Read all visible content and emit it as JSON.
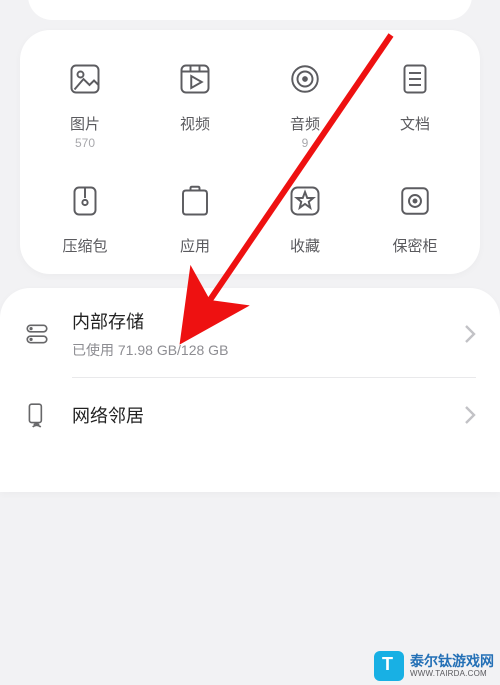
{
  "categories": [
    {
      "key": "pictures",
      "label": "图片",
      "count": "570"
    },
    {
      "key": "videos",
      "label": "视频",
      "count": ""
    },
    {
      "key": "audio",
      "label": "音频",
      "count": "9"
    },
    {
      "key": "documents",
      "label": "文档",
      "count": ""
    },
    {
      "key": "archives",
      "label": "压缩包",
      "count": ""
    },
    {
      "key": "apps",
      "label": "应用",
      "count": ""
    },
    {
      "key": "favorites",
      "label": "收藏",
      "count": ""
    },
    {
      "key": "safebox",
      "label": "保密柜",
      "count": ""
    }
  ],
  "storage": {
    "title": "内部存储",
    "subtitle": "已使用 71.98 GB/128 GB"
  },
  "network": {
    "title": "网络邻居"
  },
  "watermark": {
    "line1": "泰尔钛游戏网",
    "line2": "WWW.TAIRDA.COM"
  }
}
